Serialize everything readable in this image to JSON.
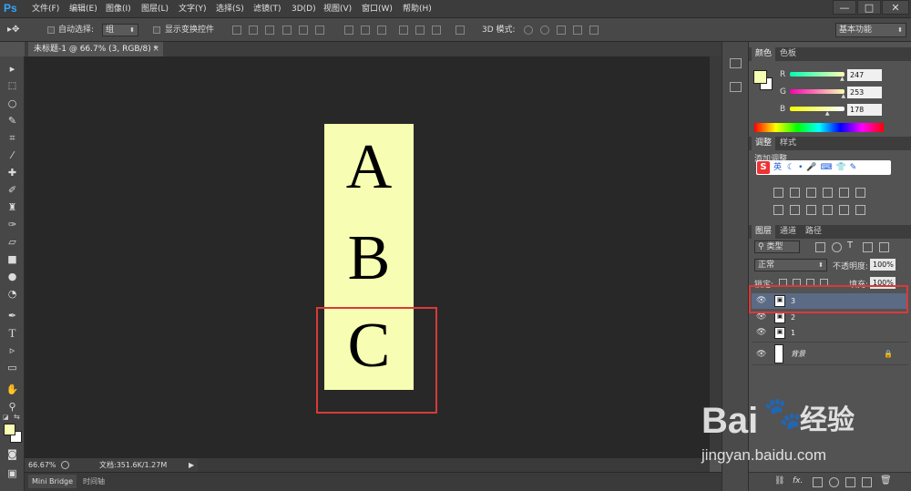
{
  "app": {
    "logo": "Ps",
    "menu": [
      "文件(F)",
      "编辑(E)",
      "图像(I)",
      "图层(L)",
      "文字(Y)",
      "选择(S)",
      "滤镜(T)",
      "3D(D)",
      "视图(V)",
      "窗口(W)",
      "帮助(H)"
    ],
    "window_buttons": [
      "—",
      "□",
      "✕"
    ]
  },
  "options": {
    "auto_select_label": "自动选择:",
    "auto_select_value": "组",
    "show_transform_label": "显示变换控件",
    "mode_3d_label": "3D 模式:",
    "workspace": "基本功能"
  },
  "document": {
    "tab_title": "未标题-1 @ 66.7% (3, RGB/8) *",
    "tab_close": "×",
    "letters": [
      "A",
      "B",
      "C"
    ],
    "bg_color": "#f7fdb2"
  },
  "status": {
    "zoom": "66.67%",
    "doc_info": "文档:351.6K/1.27M"
  },
  "bottom_tabs": [
    "Mini Bridge",
    "时间轴"
  ],
  "color_panel": {
    "tabs": [
      "颜色",
      "色板"
    ],
    "channels": [
      {
        "label": "R",
        "value": "247",
        "fraction": 0.969
      },
      {
        "label": "G",
        "value": "253",
        "fraction": 0.992
      },
      {
        "label": "B",
        "value": "178",
        "fraction": 0.698
      }
    ],
    "foreground": "#f7fdb2"
  },
  "adjust_panel": {
    "tabs": [
      "调整",
      "样式"
    ],
    "add_label": "添加调整",
    "ime_label": "英"
  },
  "layers_panel": {
    "tabs": [
      "图层",
      "通道",
      "路径"
    ],
    "filter_label": "类型",
    "blend_mode": "正常",
    "opacity_label": "不透明度:",
    "opacity_value": "100%",
    "lock_label": "锁定:",
    "fill_label": "填充:",
    "fill_value": "100%",
    "layers": [
      {
        "name": "3",
        "selected": true
      },
      {
        "name": "2",
        "selected": false
      },
      {
        "name": "1",
        "selected": false
      },
      {
        "name": "背景",
        "selected": false
      }
    ]
  },
  "watermark": {
    "brand": "Bai",
    "cn": "经验",
    "url": "jingyan.baidu.com"
  }
}
